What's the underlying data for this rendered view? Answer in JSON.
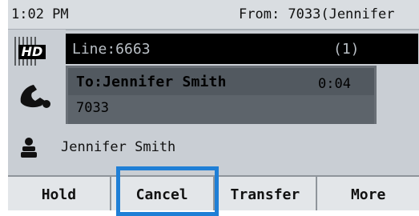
{
  "status": {
    "time": "1:02 PM",
    "from": "From: 7033(Jennifer"
  },
  "logo": {
    "text": "HD"
  },
  "line": {
    "label": "Line:6663",
    "count": "(1)"
  },
  "call": {
    "to": "To:Jennifer Smith",
    "duration": "0:04",
    "number": "7033"
  },
  "contact": {
    "name": "Jennifer Smith"
  },
  "softkeys": [
    "Hold",
    "Cancel",
    "Transfer",
    "More"
  ],
  "colors": {
    "screen_bg": "#c9ced4",
    "line_bar": "#000000",
    "highlight": "#1f7fd6"
  },
  "icons": {
    "call": "handset-icon",
    "contact": "person-icon"
  }
}
